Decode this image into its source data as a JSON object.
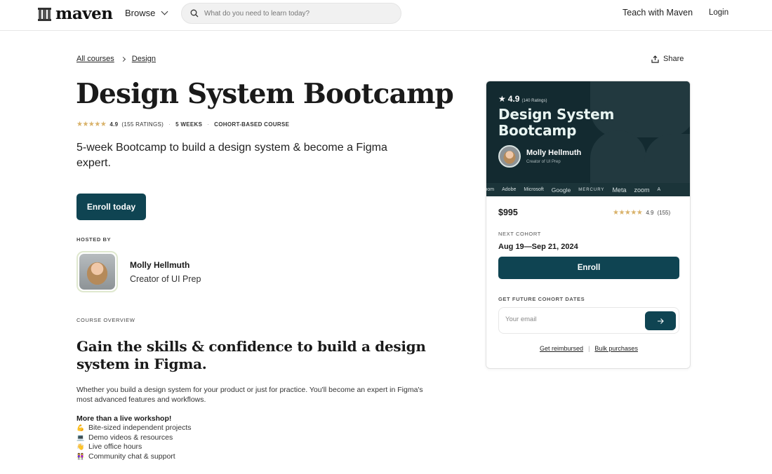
{
  "header": {
    "logo_text": "maven",
    "browse_label": "Browse",
    "search_placeholder": "What do you need to learn today?",
    "teach_label": "Teach with Maven",
    "login_label": "Login"
  },
  "breadcrumb": [
    {
      "label": "All courses"
    },
    {
      "label": "Design"
    }
  ],
  "share_label": "Share",
  "course": {
    "title": "Design System Bootcamp",
    "stars": "★★★★★",
    "rating": "4.9",
    "ratings_count": "(155 RATINGS)",
    "duration": "5 WEEKS",
    "type": "COHORT-BASED COURSE",
    "subtitle": "5-week Bootcamp to build a design system & become a Figma expert.",
    "enroll_today_label": "Enroll today"
  },
  "host": {
    "label": "HOSTED BY",
    "name": "Molly Hellmuth",
    "role": "Creator of UI Prep"
  },
  "overview": {
    "label": "COURSE OVERVIEW",
    "heading": "Gain the skills & confidence to build a design system in Figma.",
    "text": "Whether you build a design system for your product or just for practice. You'll become an expert in Figma's most advanced features and workflows.",
    "features_heading": "More than a live workshop!",
    "features": [
      {
        "emoji": "💪",
        "label": "Bite-sized independent projects"
      },
      {
        "emoji": "💻",
        "label": "Demo videos & resources"
      },
      {
        "emoji": "👋",
        "label": "Live office hours"
      },
      {
        "emoji": "👭",
        "label": "Community chat & support"
      }
    ]
  },
  "card": {
    "banner": {
      "rating": "4.9",
      "ratings_count": "(140 Ratings)",
      "title": "Design System Bootcamp",
      "host_name": "Molly Hellmuth",
      "host_role": "Creator of UI Prep",
      "logos": [
        "zoom",
        "Adobe",
        "Microsoft",
        "Google",
        "MERCURY",
        "Meta",
        "zoom",
        "A"
      ]
    },
    "price": "$995",
    "stars": "★★★★★",
    "rating": "4.9",
    "ratings_count": "(155)",
    "next_cohort_label": "NEXT COHORT",
    "next_cohort_dates": "Aug 19—Sep 21, 2024",
    "enroll_label": "Enroll",
    "future_label": "GET FUTURE COHORT DATES",
    "email_placeholder": "Your email",
    "reimbursed_label": "Get reimbursed",
    "separator": "|",
    "bulk_label": "Bulk purchases"
  },
  "colors": {
    "primary": "#0f4452",
    "banner_bg": "#132a30",
    "star": "#d9b26a"
  }
}
